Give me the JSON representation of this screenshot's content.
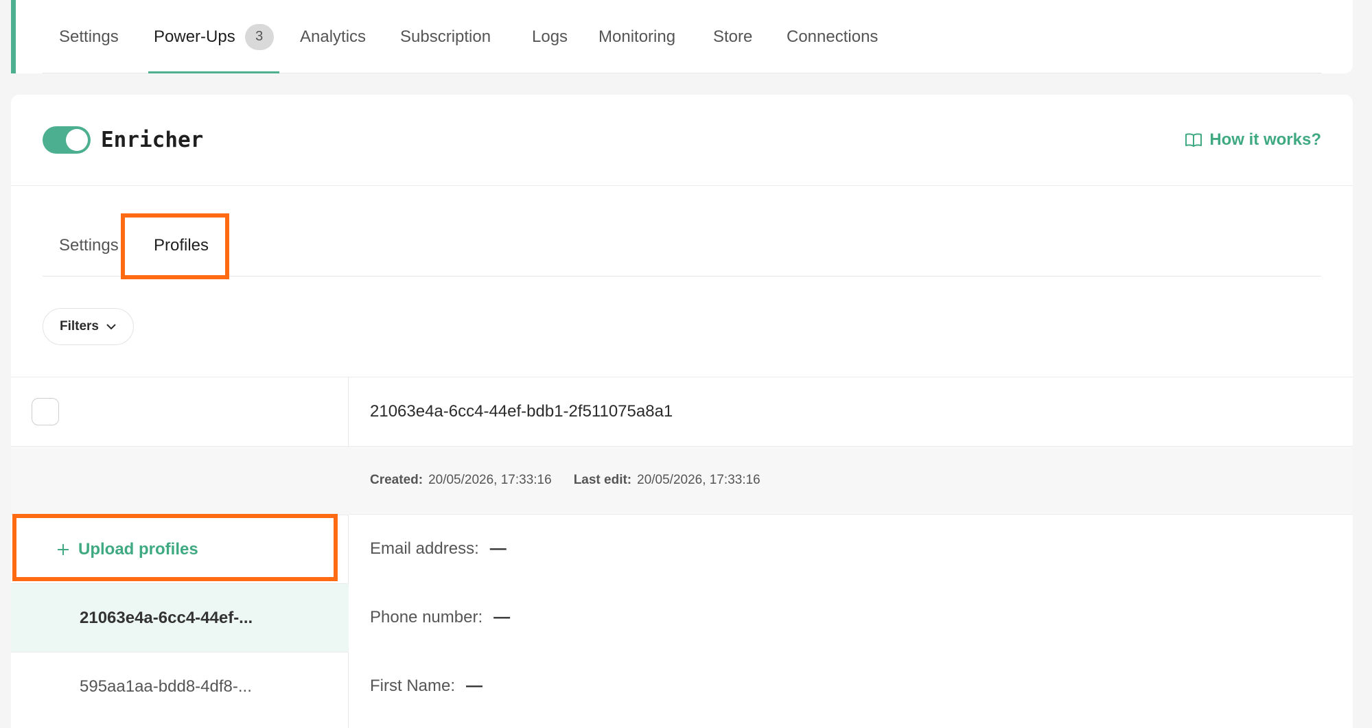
{
  "top_tabs": [
    {
      "label": "Settings",
      "active": false
    },
    {
      "label": "Power-Ups",
      "active": true,
      "badge": "3"
    },
    {
      "label": "Analytics",
      "active": false
    },
    {
      "label": "Subscription",
      "active": false
    },
    {
      "label": "Logs",
      "active": false
    },
    {
      "label": "Monitoring",
      "active": false
    },
    {
      "label": "Store",
      "active": false
    },
    {
      "label": "Connections",
      "active": false
    }
  ],
  "header": {
    "title": "Enricher",
    "toggle_on": true,
    "help_link": "How it works?",
    "help_icon": "book-icon"
  },
  "sub_tabs": [
    {
      "label": "Settings",
      "active": false
    },
    {
      "label": "Profiles",
      "active": true
    }
  ],
  "filters": {
    "label": "Filters",
    "icon": "chevron-down-icon"
  },
  "list": {
    "upload_label": "Upload profiles",
    "upload_icon": "plus-icon",
    "items": [
      {
        "label": "21063e4a-6cc4-44ef-...",
        "selected": true
      },
      {
        "label": "595aa1aa-bdd8-4df8-...",
        "selected": false
      }
    ]
  },
  "detail": {
    "profile_id": "21063e4a-6cc4-44ef-bdb1-2f511075a8a1",
    "created_label": "Created:",
    "created_value": "20/05/2026, 17:33:16",
    "last_edit_label": "Last edit:",
    "last_edit_value": "20/05/2026, 17:33:16",
    "fields": [
      {
        "label": "Email address:",
        "value": "—"
      },
      {
        "label": "Phone number:",
        "value": "—"
      },
      {
        "label": "First Name:",
        "value": "—"
      }
    ]
  },
  "colors": {
    "accent": "#4caf8f",
    "link": "#3fa982",
    "highlight": "#ff6a13",
    "selected_row": "#edf7f3"
  }
}
